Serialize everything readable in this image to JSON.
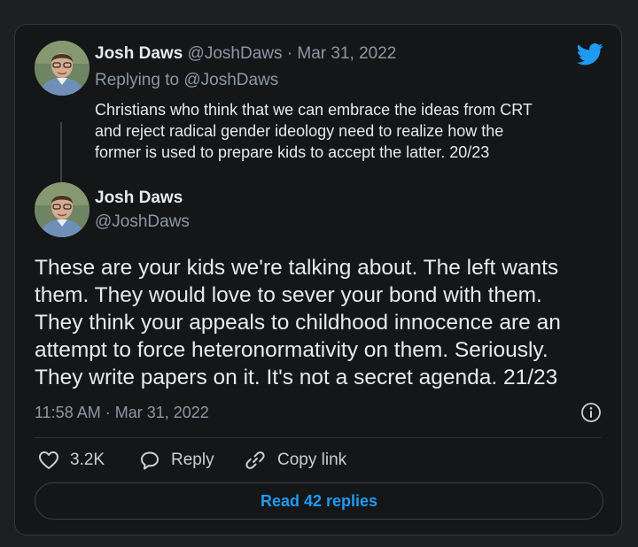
{
  "reply_tweet": {
    "author_name": "Josh Daws",
    "author_handle": "@JoshDaws",
    "separator": "·",
    "date": "Mar 31, 2022",
    "replying_label": "Replying to",
    "replying_to": "@JoshDaws",
    "text_lines": [
      "Christians who think that we can embrace the ideas from CRT",
      "and reject radical gender ideology need to realize how the",
      "former is used to prepare kids to accept the latter. 20/23"
    ]
  },
  "main_tweet": {
    "author_name": "Josh Daws",
    "author_handle": "@JoshDaws",
    "text_lines": [
      "These are your kids we're talking about. The left wants",
      "them. They would love to sever your bond with them.",
      "They think your appeals to childhood innocence are an",
      "attempt to force heteronormativity on them. Seriously.",
      "They write papers on it. It's not a secret agenda. 21/23"
    ],
    "timestamp": "11:58 AM · Mar 31, 2022"
  },
  "actions": {
    "like_count": "3.2K",
    "reply_label": "Reply",
    "copy_link_label": "Copy link"
  },
  "read_replies_label": "Read 42 replies",
  "icons": [
    "twitter-bird-icon",
    "info-icon",
    "heart-icon",
    "reply-bubble-icon",
    "link-icon"
  ],
  "colors": {
    "card_background": "#151618",
    "page_background": "#1e1f22",
    "accent": "#1d9bf0",
    "muted_text": "#8b98a5"
  }
}
